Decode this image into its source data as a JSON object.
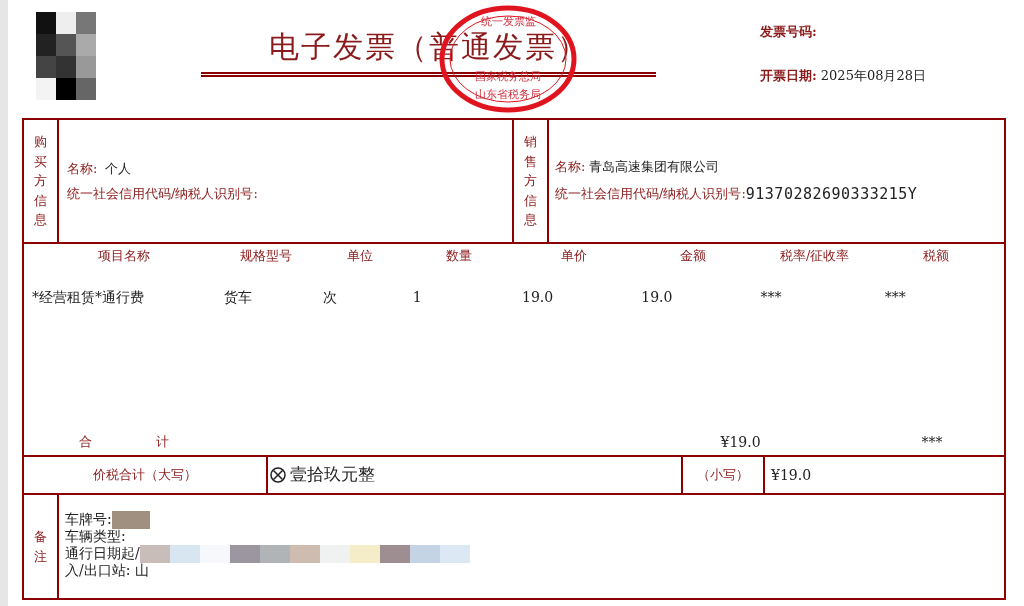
{
  "header": {
    "title": "电子发票（普通发票）",
    "invoice_number_label": "发票号码:",
    "issue_date_label": "开票日期:",
    "issue_date": "2025年08月28日"
  },
  "stamp": {
    "texts": [
      "统一发票监",
      "国家税务总局",
      "山东省税务局"
    ]
  },
  "buyer": {
    "section_label": "购买方信息",
    "name_label": "名称:",
    "name": "个人",
    "tax_id_label": "统一社会信用代码/纳税人识别号:"
  },
  "seller": {
    "section_label": "销售方信息",
    "name_label": "名称:",
    "name": "青岛高速集团有限公司",
    "tax_id_label": "统一社会信用代码/纳税人识别号:",
    "tax_id": "91370282690333215Y"
  },
  "items": {
    "columns": [
      "项目名称",
      "规格型号",
      "单位",
      "数量",
      "单价",
      "金额",
      "税率/征收率",
      "税额"
    ],
    "rows": [
      [
        "*经营租赁*通行费",
        "货车",
        "次",
        "1",
        "19.0",
        "19.0",
        "***",
        "***"
      ]
    ]
  },
  "totals": {
    "label": "合 计",
    "amount": "¥19.0",
    "tax": "***"
  },
  "price_total": {
    "label": "价税合计（大写）",
    "words": "壹拾玖元整",
    "small_label": "（小写）",
    "value": "¥19.0"
  },
  "remarks": {
    "label": "备注",
    "lines": [
      "车牌号:",
      "车辆类型:",
      "通行日期起/",
      "入/出口站: 山"
    ]
  }
}
